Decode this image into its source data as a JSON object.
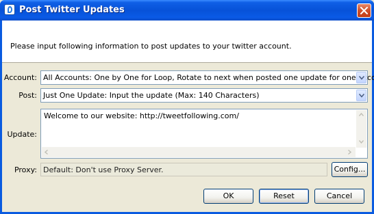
{
  "window": {
    "title": "Post Twitter Updates",
    "icons": {
      "app": "app-icon",
      "close": "close-icon"
    }
  },
  "header": {
    "text": "Please input following information to post updates to your twitter account."
  },
  "form": {
    "account": {
      "label": "Account:",
      "value": "All Accounts: One by One for Loop, Rotate to next when posted one update for one account"
    },
    "post": {
      "label": "Post:",
      "value": "Just One Update: Input the update (Max: 140 Characters)"
    },
    "update": {
      "label": "Update:",
      "value": "Welcome to our website: http://tweetfollowing.com/"
    },
    "proxy": {
      "label": "Proxy:",
      "value": "Default: Don't use Proxy Server.",
      "config_label": "Config..."
    }
  },
  "buttons": {
    "ok": "OK",
    "reset": "Reset",
    "cancel": "Cancel"
  },
  "colors": {
    "titlebar": "#0752d8",
    "dialog_bg": "#ece9d8",
    "field_border": "#7f9db9"
  }
}
